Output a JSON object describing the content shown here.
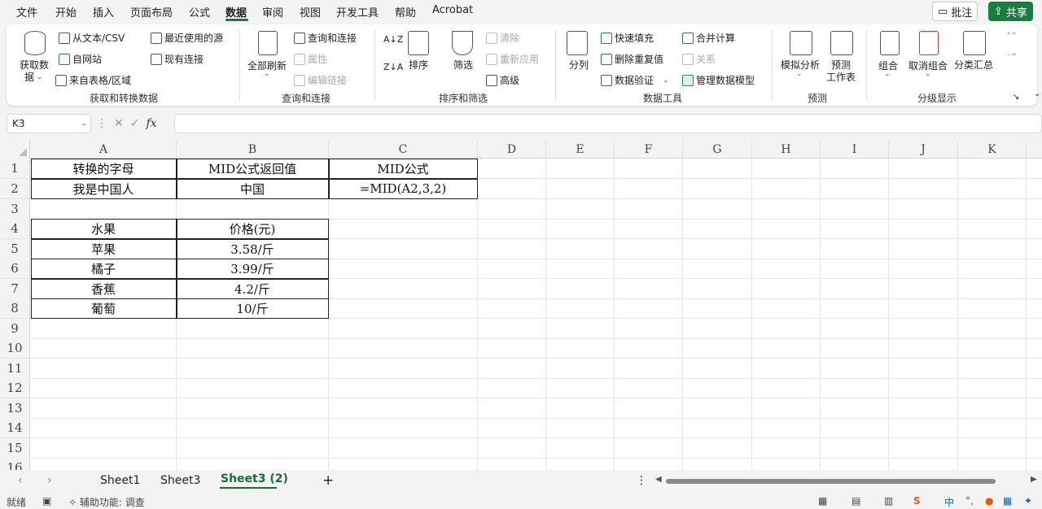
{
  "menu": {
    "items": [
      "文件",
      "开始",
      "插入",
      "页面布局",
      "公式",
      "数据",
      "审阅",
      "视图",
      "开发工具",
      "帮助",
      "Acrobat"
    ],
    "active": "数据",
    "comment_label": "批注",
    "share_label": "共享"
  },
  "ribbon": {
    "get_transform": {
      "get_data": "获取数",
      "get_data2": "据",
      "from_text_csv": "从文本/CSV",
      "from_web": "自网站",
      "from_table": "来自表格/区域",
      "recent_sources": "最近使用的源",
      "existing_connections": "现有连接",
      "group_label": "获取和转换数据"
    },
    "queries": {
      "refresh_all": "全部刷新",
      "queries_connections": "查询和连接",
      "properties": "属性",
      "edit_links": "编辑链接",
      "group_label": "查询和连接"
    },
    "sort_filter": {
      "sort": "排序",
      "filter": "筛选",
      "clear": "清除",
      "reapply": "重新应用",
      "advanced": "高级",
      "group_label": "排序和筛选"
    },
    "data_tools": {
      "text_to_columns": "分列",
      "flash_fill": "快速填充",
      "remove_duplicates": "删除重复值",
      "data_validation": "数据验证",
      "consolidate": "合并计算",
      "relationships": "关系",
      "data_model": "管理数据模型",
      "group_label": "数据工具"
    },
    "forecast": {
      "what_if": "模拟分析",
      "forecast_sheet": "预测",
      "forecast_sheet2": "工作表",
      "group_label": "预测"
    },
    "outline": {
      "group": "组合",
      "ungroup": "取消组合",
      "subtotal": "分类汇总",
      "group_label": "分级显示"
    }
  },
  "formula_bar": {
    "name_box": "K3",
    "fx": "fx",
    "formula": ""
  },
  "columns": [
    "A",
    "B",
    "C",
    "D",
    "E",
    "F",
    "G",
    "H",
    "I",
    "J",
    "K"
  ],
  "rows": [
    "1",
    "2",
    "3",
    "4",
    "5",
    "6",
    "7",
    "8",
    "9",
    "10",
    "11",
    "12",
    "13",
    "14",
    "15",
    "16"
  ],
  "table1": {
    "header": [
      "转换的字母",
      "MID公式返回值",
      "MID公式"
    ],
    "row": [
      "我是中国人",
      "中国",
      "=MID(A2,3,2)"
    ]
  },
  "table2": {
    "header": [
      "水果",
      "价格(元)"
    ],
    "rows": [
      [
        "苹果",
        "3.58/斤"
      ],
      [
        "橘子",
        "3.99/斤"
      ],
      [
        "香蕉",
        "4.2/斤"
      ],
      [
        "葡萄",
        "10/斤"
      ]
    ]
  },
  "sheets": [
    "Sheet1",
    "Sheet3",
    "Sheet3 (2)"
  ],
  "active_sheet": "Sheet3 (2)",
  "status": {
    "ready": "就绪",
    "accessibility": "辅助功能: 调查"
  }
}
